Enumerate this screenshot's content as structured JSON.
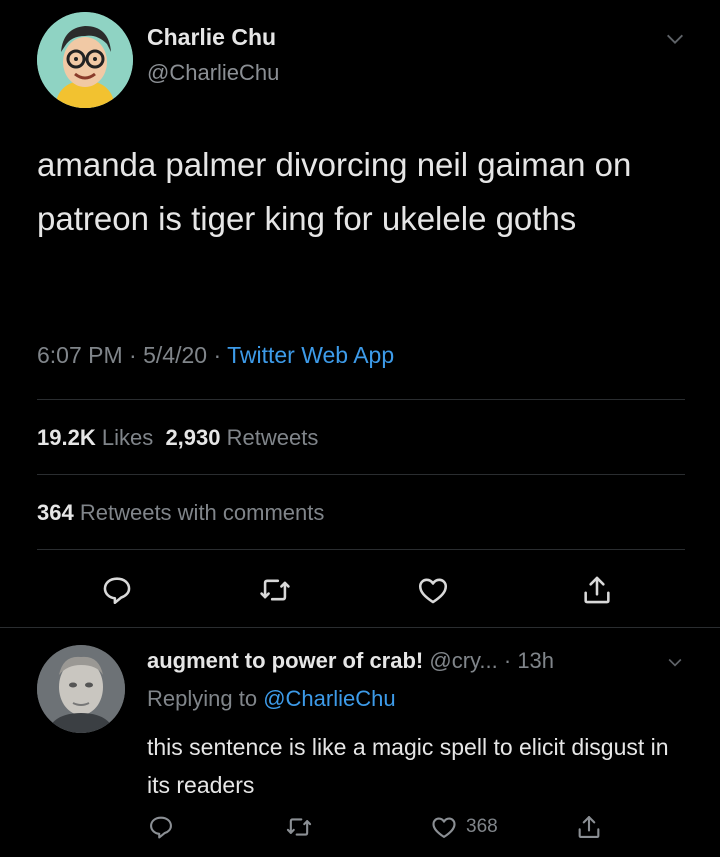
{
  "tweet": {
    "author_name": "Charlie Chu",
    "author_handle": "@CharlieChu",
    "text": "amanda palmer divorcing neil gaiman on patreon is tiger king for ukelele goths",
    "time": "6:07 PM",
    "date": "5/4/20",
    "source": "Twitter Web App",
    "separator": " · "
  },
  "stats": {
    "likes_count": "19.2K",
    "likes_label": "Likes",
    "retweets_count": "2,930",
    "retweets_label": "Retweets",
    "quote_count": "364",
    "quote_label": "Retweets with comments"
  },
  "reply": {
    "author_name": "augment to power of crab!",
    "author_handle": "@cry...",
    "time": "· 13h",
    "replying_label": "Replying to",
    "replying_to": "@CharlieChu",
    "text": "this sentence is like a magic spell to elicit disgust in its readers",
    "like_count": "368"
  },
  "icons": {
    "reply": "reply-icon",
    "retweet": "retweet-icon",
    "like": "heart-icon",
    "share": "share-icon",
    "caret": "chevron-down-icon"
  },
  "colors": {
    "background": "#000000",
    "text": "#e6e6e6",
    "muted": "#80858a",
    "link": "#3d9be9",
    "divider": "#2a2d30"
  }
}
